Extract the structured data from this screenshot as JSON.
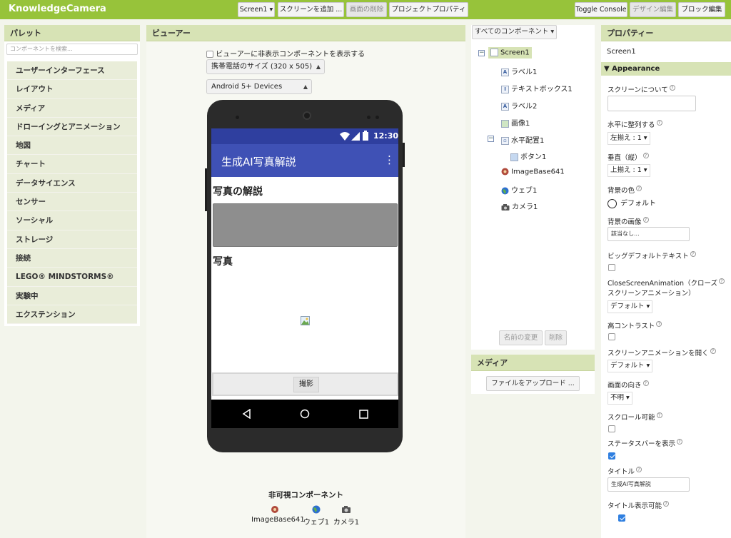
{
  "app": {
    "title": "KnowledgeCamera"
  },
  "toolbar": {
    "screen_select": "Screen1 ▾",
    "add_screen": "スクリーンを追加 ...",
    "remove_screen": "画面の削除",
    "project_properties": "プロジェクトプロパティ",
    "toggle_console": "Toggle Console",
    "designer": "デザイン編集",
    "blocks": "ブロック編集"
  },
  "palette": {
    "title": "パレット",
    "search_placeholder": "コンポーネントを検索...",
    "items": [
      "ユーザーインターフェース",
      "レイアウト",
      "メディア",
      "ドローイングとアニメーション",
      "地図",
      "チャート",
      "データサイエンス",
      "センサー",
      "ソーシャル",
      "ストレージ",
      "接続",
      "LEGO® MINDSTORMS®",
      "実験中",
      "エクステンション"
    ]
  },
  "viewer": {
    "title": "ビューアー",
    "show_hidden": "ビューアーに非表示コンポーネントを表示する",
    "size_select": "携帯電話のサイズ (320 x 505)",
    "theme_select": "Android 5+ Devices",
    "status_time": "12:30",
    "app_title": "生成AI写真解説",
    "menu_glyph": "⋮",
    "label1": "写真の解説",
    "label2": "写真",
    "button1": "撮影",
    "nonvisible_title": "非可視コンポーネント",
    "nonvisible": [
      {
        "label": "ImageBase641",
        "icon": "image-base64-icon"
      },
      {
        "label": "ウェブ1",
        "icon": "globe-icon"
      },
      {
        "label": "カメラ1",
        "icon": "camera-icon"
      }
    ]
  },
  "components": {
    "dropdown": "すべてのコンポーネント ▾",
    "tree": {
      "screen": "Screen1",
      "label1": "ラベル1",
      "textbox1": "テキストボックス1",
      "label2": "ラベル2",
      "image1": "画像1",
      "hz1": "水平配置1",
      "button1": "ボタン1",
      "imagebase": "ImageBase641",
      "web1": "ウェブ1",
      "camera1": "カメラ1"
    },
    "rename": "名前の変更",
    "delete": "削除"
  },
  "media": {
    "title": "メディア",
    "upload": "ファイルをアップロード ..."
  },
  "properties": {
    "title": "プロパティー",
    "component": "Screen1",
    "section": "▼ Appearance",
    "about_screen": "スクリーンについて",
    "align_h": "水平に整列する",
    "align_h_val": "左揃え : 1 ▾",
    "align_v": "垂直（縦）",
    "align_v_val": "上揃え : 1 ▾",
    "bg_color": "背景の色",
    "bg_color_val": "デフォルト",
    "bg_image": "背景の画像",
    "bg_image_val": "該当なし...",
    "big_default_text": "ビッグデフォルトテキスト",
    "close_anim": "CloseScreenAnimation（クローズ",
    "close_anim2": "スクリーンアニメーション）",
    "close_anim_val": "デフォルト ▾",
    "high_contrast": "高コントラスト",
    "open_anim": "スクリーンアニメーションを開く",
    "open_anim_val": "デフォルト ▾",
    "orientation": "画面の向き",
    "orientation_val": "不明 ▾",
    "scrollable": "スクロール可能",
    "show_statusbar": "ステータスバーを表示",
    "title_label": "タイトル",
    "title_val": "生成AI写真解説",
    "title_visible": "タイトル表示可能",
    "q": "?"
  }
}
